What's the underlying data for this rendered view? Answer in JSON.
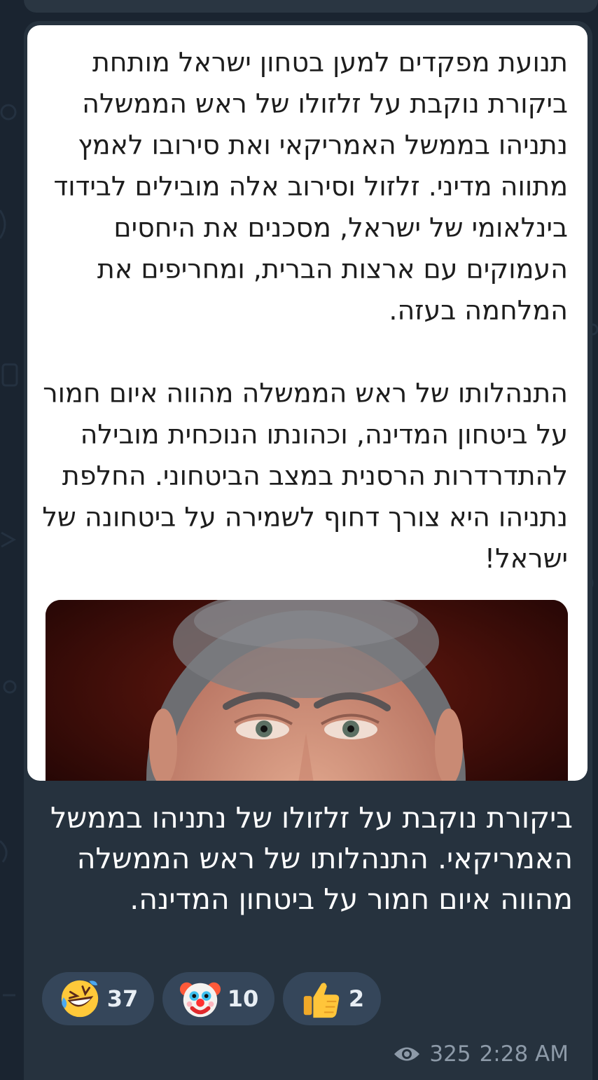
{
  "post": {
    "card_paragraph_1": "תנועת מפקדים למען בטחון ישראל מותחת ביקורת נוקבת על זלזולו של ראש הממשלה נתניהו בממשל האמריקאי ואת סירובו לאמץ מתווה מדיני. זלזול וסירוב אלה מובילים לבידוד בינלאומי של ישראל, מסכנים את היחסים העמוקים עם ארצות הברית, ומחריפים את המלחמה בעזה.",
    "card_paragraph_2": "התנהלותו של ראש הממשלה מהווה איום חמור על ביטחון המדינה, וכהונתו הנוכחית מובילה להתדרדרות הרסנית במצב הביטחוני. החלפת נתניהו היא צורך דחוף לשמירה על ביטחונה של ישראל!",
    "caption": "ביקורת נוקבת על זלזולו של נתניהו בממשל האמריקאי. התנהלותו של ראש הממשלה מהווה איום חמור על ביטחון המדינה."
  },
  "reactions": [
    {
      "icon": "rofl-emoji-icon",
      "count": "37"
    },
    {
      "icon": "clown-emoji-icon",
      "count": "10"
    },
    {
      "icon": "thumbs-up-emoji-icon",
      "count": "2"
    }
  ],
  "meta": {
    "views": "325",
    "time": "2:28 AM",
    "views_icon": "eye-icon"
  },
  "colors": {
    "chat_background": "#1a2430",
    "bubble": "#26323e",
    "reaction_pill": "#35465a",
    "meta_text": "#8d9aa8"
  }
}
